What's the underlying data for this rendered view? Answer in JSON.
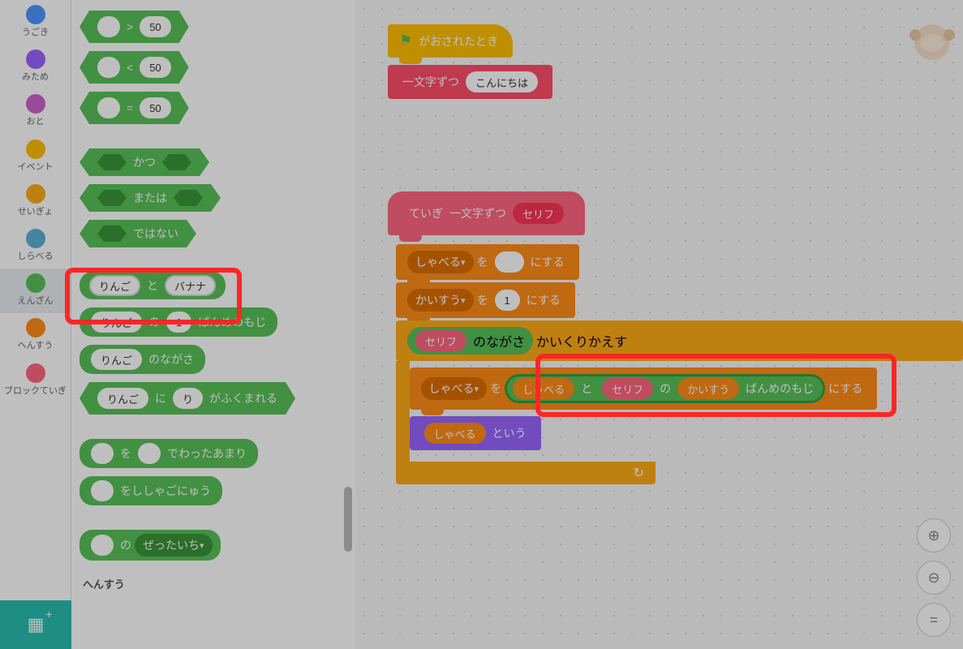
{
  "categories": [
    {
      "name": "うごき",
      "color": "#4c97ff"
    },
    {
      "name": "みため",
      "color": "#9966ff"
    },
    {
      "name": "おと",
      "color": "#cf63cf"
    },
    {
      "name": "イベント",
      "color": "#ffbf00"
    },
    {
      "name": "せいぎょ",
      "color": "#ffab19"
    },
    {
      "name": "しらべる",
      "color": "#5cb1d6"
    },
    {
      "name": "えんざん",
      "color": "#59c059",
      "selected": true
    },
    {
      "name": "へんすう",
      "color": "#ff8c1a"
    },
    {
      "name": "ブロックていぎ",
      "color": "#ff6680"
    }
  ],
  "palette": {
    "gt_val": "50",
    "lt_val": "50",
    "eq_val": "50",
    "and_label": "かつ",
    "or_label": "または",
    "not_label": "ではない",
    "join_a": "りんご",
    "join_to": "と",
    "join_b": "バナナ",
    "letter_of_a": "りんご",
    "letter_of_no": "の",
    "letter_of_idx": "1",
    "letter_of_tail": "ばんめのもじ",
    "length_a": "りんご",
    "length_tail": "のながさ",
    "contains_a": "りんご",
    "contains_ni": "に",
    "contains_b": "り",
    "contains_tail": "がふくまれる",
    "mod_wo": "を",
    "mod_tail": "でわったあまり",
    "round_tail": "をししゃごにゅう",
    "abs_no": "の",
    "abs_op": "ぜったいち",
    "var_section": "へんすう"
  },
  "workspace": {
    "hat_flag_tail": "がおされたとき",
    "call_block": "一文字ずつ",
    "call_arg": "こんにちは",
    "def_prefix": "ていぎ",
    "def_name": "一文字ずつ",
    "def_param": "セリフ",
    "set1_var": "しゃべる",
    "set1_wo": "を",
    "set1_val": "",
    "set1_tail": "にする",
    "set2_var": "かいすう",
    "set2_wo": "を",
    "set2_val": "1",
    "set2_tail": "にする",
    "repeat_param": "セリフ",
    "repeat_mid": "のながさ",
    "repeat_tail": "かいくりかえす",
    "inner_set_var": "しゃべる",
    "inner_set_wo": "を",
    "inner_tail": "にする",
    "join_left_var": "しゃべる",
    "join_to": "と",
    "join_right_param": "セリフ",
    "join_right_no": "の",
    "join_right_var": "かいすう",
    "join_right_tail": "ばんめのもじ",
    "say_var": "しゃべる",
    "say_tail": "という"
  }
}
